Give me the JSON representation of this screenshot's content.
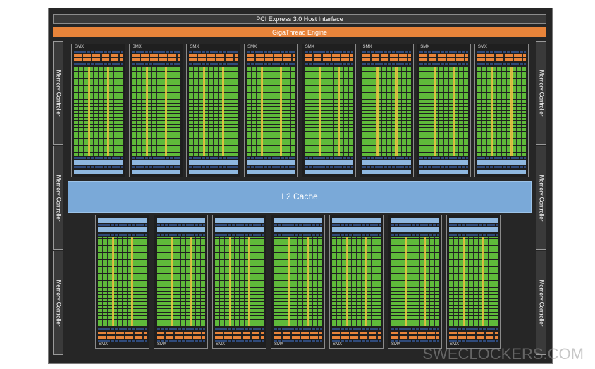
{
  "host_interface": "PCI Express 3.0 Host Interface",
  "gigathread": "GigaThread Engine",
  "memory_controllers": [
    "Memory Controller",
    "Memory Controller",
    "Memory Controller",
    "Memory Controller",
    "Memory Controller",
    "Memory Controller"
  ],
  "l2_cache": "L2 Cache",
  "smx_label": "SMX",
  "smx_top_count": 8,
  "smx_bottom_count": 7,
  "watermark": "SWECLOCKERS.COM",
  "colors": {
    "die": "#262626",
    "gigathread": "#e8843a",
    "l2": "#7aa9d8",
    "core_green": "#5fba3a",
    "core_yellow": "#e7c542"
  }
}
